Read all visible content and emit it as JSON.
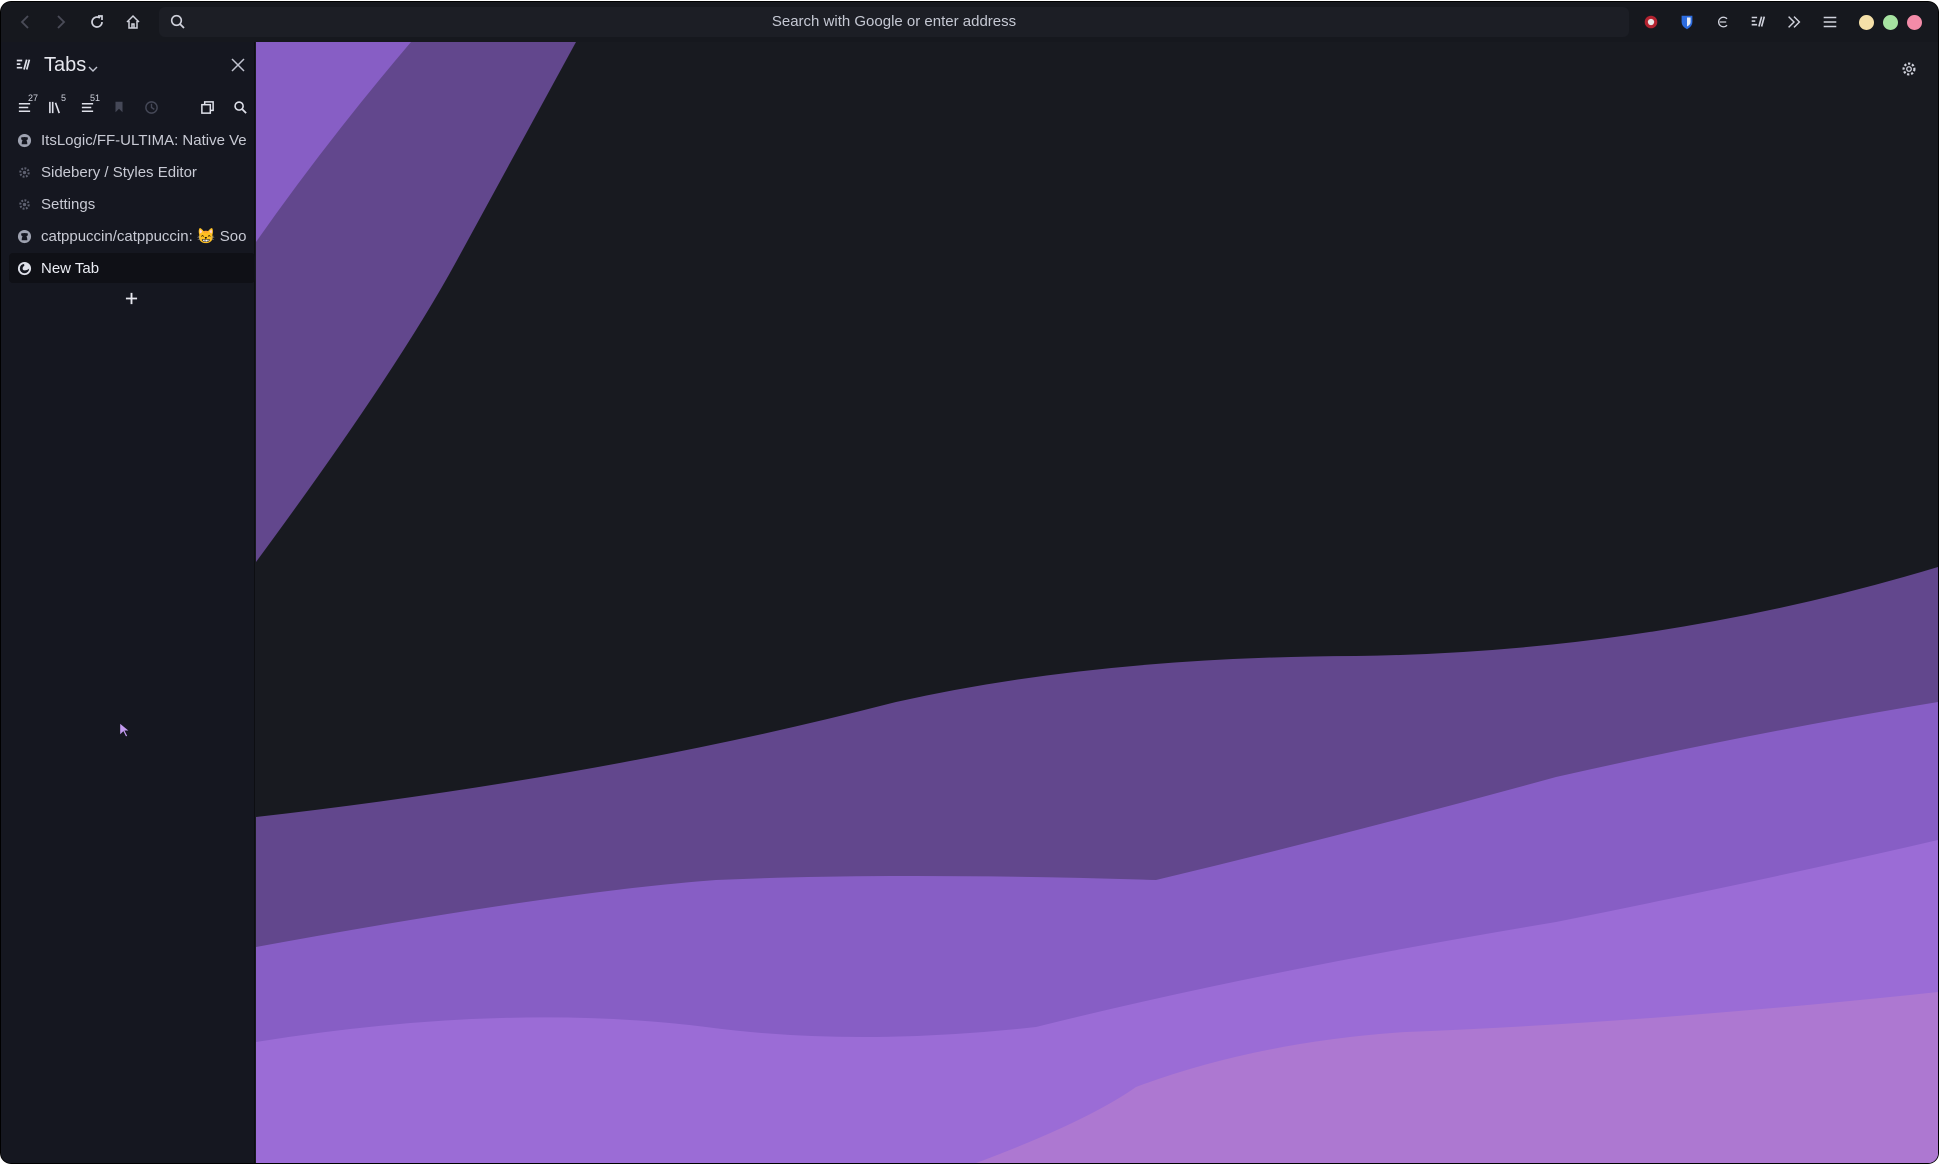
{
  "toolbar": {
    "back_icon": "chevron-left-icon",
    "forward_icon": "chevron-right-icon",
    "reload_icon": "reload-icon",
    "home_icon": "home-icon",
    "search_icon": "search-icon",
    "url_placeholder": "Search with Google or enter address",
    "extensions": [
      "ublock-icon",
      "bitwarden-icon",
      "extension-icon",
      "sidebery-icon"
    ],
    "overflow_icon": "chevrons-right-icon",
    "menu_icon": "hamburger-menu-icon"
  },
  "window_controls": {
    "minimize_color": "#f5e0a8",
    "maximize_color": "#a6e3a1",
    "close_color": "#f38ba8"
  },
  "sidebar": {
    "title": "Tabs",
    "tools": [
      {
        "name": "tabs-panel",
        "badge": "27"
      },
      {
        "name": "bookmarks-panel",
        "badge": "5"
      },
      {
        "name": "history-list-panel",
        "badge": "51"
      },
      {
        "name": "pinned-panel",
        "badge": ""
      },
      {
        "name": "recent-panel",
        "badge": ""
      }
    ],
    "tabs": [
      {
        "title": "ItsLogic/FF-ULTIMA: Native Ve",
        "icon": "github-icon",
        "active": false
      },
      {
        "title": "Sidebery / Styles Editor",
        "icon": "gear-icon",
        "active": false
      },
      {
        "title": "Settings",
        "icon": "gear-icon",
        "active": false
      },
      {
        "title": "catppuccin/catppuccin: 😸 Soo",
        "icon": "github-icon",
        "active": false
      },
      {
        "title": "New Tab",
        "icon": "firefox-icon",
        "active": true
      }
    ]
  },
  "colors": {
    "background": "#181a20",
    "accent_dark": "#62478d",
    "accent_mid": "#875ec5",
    "accent_light": "#9b6cd6",
    "accent_pink": "#ad78d1"
  }
}
